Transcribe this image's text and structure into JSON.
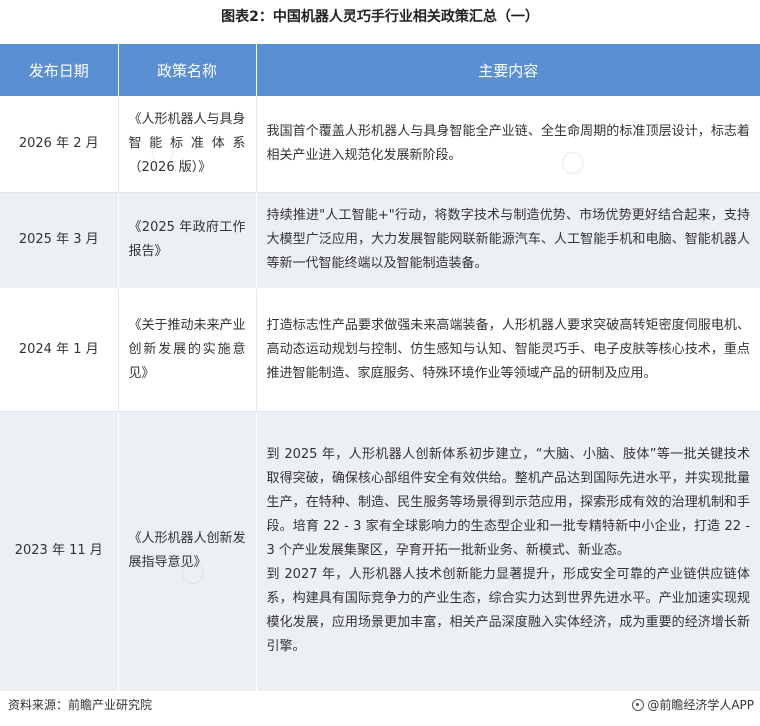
{
  "title": "图表2：中国机器人灵巧手行业相关政策汇总（一）",
  "table": {
    "headers": [
      "发布日期",
      "政策名称",
      "主要内容"
    ],
    "rows": [
      {
        "date": "2026 年 2 月",
        "name": "《人形机器人与具身智能标准体系（2026 版）》",
        "content": [
          "我国首个覆盖人形机器人与具身智能全产业链、全生命周期的标准顶层设计，标志着相关产业进入规范化发展新阶段。"
        ]
      },
      {
        "date": "2025 年 3 月",
        "name": "《2025 年政府工作报告》",
        "content": [
          "持续推进\"人工智能+\"行动，将数字技术与制造优势、市场优势更好结合起来，支持大模型广泛应用，大力发展智能网联新能源汽车、人工智能手机和电脑、智能机器人等新一代智能终端以及智能制造装备。"
        ]
      },
      {
        "date": "2024 年 1 月",
        "name": "《关于推动未来产业创新发展的实施意见》",
        "content": [
          "打造标志性产品要求做强未来高端装备，人形机器人要求突破高转矩密度伺服电机、高动态运动规划与控制、仿生感知与认知、智能灵巧手、电子皮肤等核心技术，重点推进智能制造、家庭服务、特殊环境作业等领域产品的研制及应用。"
        ]
      },
      {
        "date": "2023 年 11 月",
        "name": "《人形机器人创新发展指导意见》",
        "content": [
          "到 2025 年，人形机器人创新体系初步建立，“大脑、小脑、肢体”等一批关键技术取得突破，确保核心部组件安全有效供给。整机产品达到国际先进水平，并实现批量生产，在特种、制造、民生服务等场景得到示范应用，探索形成有效的治理机制和手段。培育 22 - 3 家有全球影响力的生态型企业和一批专精特新中小企业，打造 22 - 3 个产业发展集聚区，孕育开拓一批新业务、新模式、新业态。",
          "到 2027 年，人形机器人技术创新能力显著提升，形成安全可靠的产业链供应链体系，构建具有国际竞争力的产业生态，综合实力达到世界先进水平。产业加速实现规模化发展，应用场景更加丰富，相关产品深度融入实体经济，成为重要的经济增长新引擎。"
        ]
      }
    ]
  },
  "footer": {
    "source": "资料来源：前瞻产业研究院",
    "brand": "@前瞻经济学人APP",
    "logo_icon": "qianzhan-logo-icon"
  }
}
